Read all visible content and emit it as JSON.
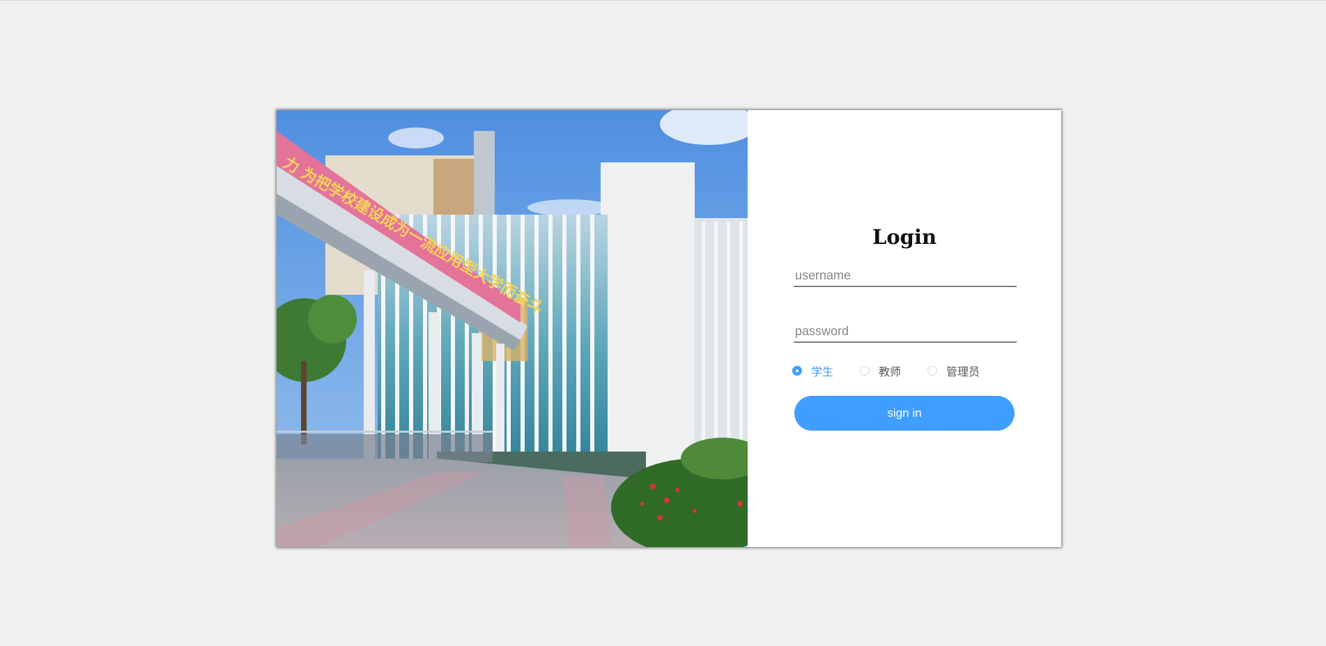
{
  "login": {
    "title": "Login",
    "username_placeholder": "username",
    "password_placeholder": "password",
    "roles": [
      {
        "label": "学生",
        "checked": true
      },
      {
        "label": "教师",
        "checked": false
      },
      {
        "label": "管理员",
        "checked": false
      }
    ],
    "signin_label": "sign in"
  },
  "banner": {
    "text": "力 为把学校建设成为一流应用型大学而奋斗"
  },
  "colors": {
    "accent": "#409eff",
    "page_bg": "#f0f0f0"
  }
}
